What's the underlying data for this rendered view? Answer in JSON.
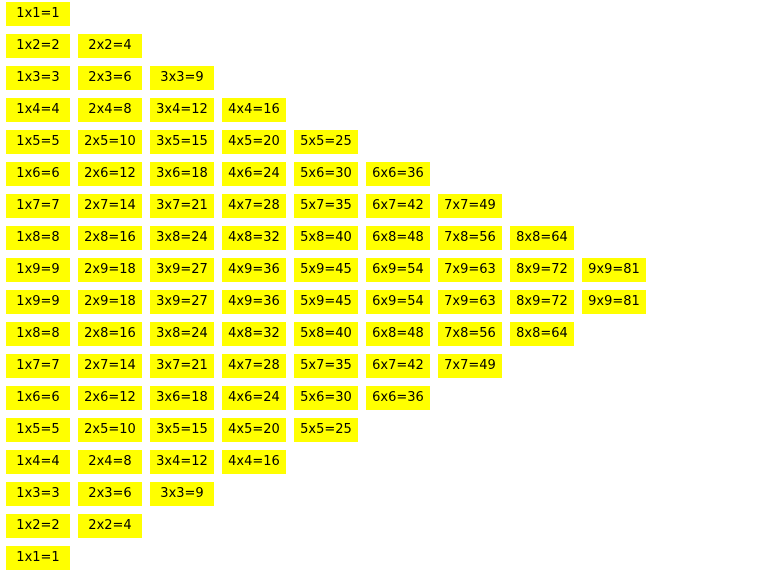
{
  "cell_color": "#ffff00",
  "text_color": "#000000",
  "rows": [
    [
      "1x1=1"
    ],
    [
      "1x2=2",
      "2x2=4"
    ],
    [
      "1x3=3",
      "2x3=6",
      "3x3=9"
    ],
    [
      "1x4=4",
      "2x4=8",
      "3x4=12",
      "4x4=16"
    ],
    [
      "1x5=5",
      "2x5=10",
      "3x5=15",
      "4x5=20",
      "5x5=25"
    ],
    [
      "1x6=6",
      "2x6=12",
      "3x6=18",
      "4x6=24",
      "5x6=30",
      "6x6=36"
    ],
    [
      "1x7=7",
      "2x7=14",
      "3x7=21",
      "4x7=28",
      "5x7=35",
      "6x7=42",
      "7x7=49"
    ],
    [
      "1x8=8",
      "2x8=16",
      "3x8=24",
      "4x8=32",
      "5x8=40",
      "6x8=48",
      "7x8=56",
      "8x8=64"
    ],
    [
      "1x9=9",
      "2x9=18",
      "3x9=27",
      "4x9=36",
      "5x9=45",
      "6x9=54",
      "7x9=63",
      "8x9=72",
      "9x9=81"
    ],
    [
      "1x9=9",
      "2x9=18",
      "3x9=27",
      "4x9=36",
      "5x9=45",
      "6x9=54",
      "7x9=63",
      "8x9=72",
      "9x9=81"
    ],
    [
      "1x8=8",
      "2x8=16",
      "3x8=24",
      "4x8=32",
      "5x8=40",
      "6x8=48",
      "7x8=56",
      "8x8=64"
    ],
    [
      "1x7=7",
      "2x7=14",
      "3x7=21",
      "4x7=28",
      "5x7=35",
      "6x7=42",
      "7x7=49"
    ],
    [
      "1x6=6",
      "2x6=12",
      "3x6=18",
      "4x6=24",
      "5x6=30",
      "6x6=36"
    ],
    [
      "1x5=5",
      "2x5=10",
      "3x5=15",
      "4x5=20",
      "5x5=25"
    ],
    [
      "1x4=4",
      "2x4=8",
      "3x4=12",
      "4x4=16"
    ],
    [
      "1x3=3",
      "2x3=6",
      "3x3=9"
    ],
    [
      "1x2=2",
      "2x2=4"
    ],
    [
      "1x1=1"
    ]
  ]
}
